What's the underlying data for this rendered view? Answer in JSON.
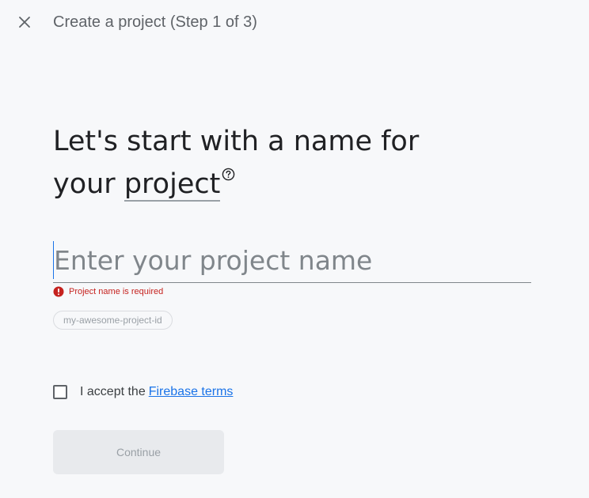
{
  "header": {
    "close_icon": "close-icon",
    "title": "Create a project (Step 1 of 3)"
  },
  "main": {
    "heading_part1": "Let's start with a name for",
    "heading_part2": "your",
    "heading_term": "project",
    "help_icon": "help-circle-icon",
    "name_input": {
      "value": "",
      "placeholder": "Enter your project name"
    },
    "error": {
      "icon": "error-icon",
      "text": "Project name is required"
    },
    "project_id_chip": "my-awesome-project-id",
    "terms": {
      "checked": false,
      "text": "I accept the",
      "link": "Firebase terms"
    },
    "continue_label": "Continue"
  },
  "colors": {
    "background": "#f7f8fa",
    "accent": "#1a73e8",
    "error": "#c5221f",
    "disabled_button": "#e8eaed"
  }
}
